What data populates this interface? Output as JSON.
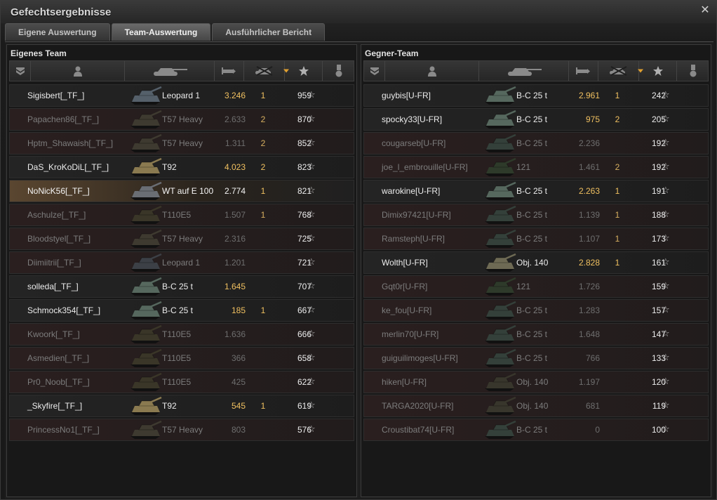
{
  "window": {
    "title": "Gefechtsergebnisse"
  },
  "tabs": [
    "Eigene Auswertung",
    "Team-Auswertung",
    "Ausführlicher Bericht"
  ],
  "active_tab": 1,
  "icons": {
    "close": "close-icon",
    "columns": [
      "rank-chevron-icon",
      "player-icon",
      "tank-icon",
      "damage-icon",
      "kills-icon",
      "star-icon",
      "medal-icon"
    ],
    "row_star": "☆"
  },
  "colors": {
    "damage_alive": "#f0c060",
    "self_row": "#5a4630"
  },
  "own_team": {
    "title": "Eigenes Team",
    "rows": [
      {
        "player": "Sigisbert[_TF_]",
        "tank": "Leopard 1",
        "damage": "3.246",
        "frags": "1",
        "xp": "959",
        "state": "alive",
        "tank_color": "#55606a"
      },
      {
        "player": "Papachen86[_TF_]",
        "tank": "T57 Heavy",
        "damage": "2.633",
        "frags": "2",
        "xp": "870",
        "state": "dead",
        "tank_color": "#3e3a30"
      },
      {
        "player": "Hptm_Shawaish[_TF_]",
        "tank": "T57 Heavy",
        "damage": "1.311",
        "frags": "2",
        "xp": "852",
        "state": "dead",
        "tank_color": "#3e3a30"
      },
      {
        "player": "DaS_KroKoDiL[_TF_]",
        "tank": "T92",
        "damage": "4.023",
        "frags": "2",
        "xp": "823",
        "state": "alive",
        "tank_color": "#8a7a50"
      },
      {
        "player": "NoNicK56[_TF_]",
        "tank": "WT auf E 100",
        "damage": "2.774",
        "frags": "1",
        "xp": "821",
        "state": "self",
        "tank_color": "#6a6e74"
      },
      {
        "player": "Aschulze[_TF_]",
        "tank": "T110E5",
        "damage": "1.507",
        "frags": "1",
        "xp": "768",
        "state": "dead",
        "tank_color": "#3a3628"
      },
      {
        "player": "Bloodstyel[_TF_]",
        "tank": "T57 Heavy",
        "damage": "2.316",
        "frags": "",
        "xp": "725",
        "state": "dead",
        "tank_color": "#3e3a30"
      },
      {
        "player": "Diimiitrii[_TF_]",
        "tank": "Leopard 1",
        "damage": "1.201",
        "frags": "",
        "xp": "721",
        "state": "dead",
        "tank_color": "#3c4046"
      },
      {
        "player": "solleda[_TF_]",
        "tank": "B-C 25 t",
        "damage": "1.645",
        "frags": "",
        "xp": "707",
        "state": "alive",
        "tank_color": "#56685e"
      },
      {
        "player": "Schmock354[_TF_]",
        "tank": "B-C 25 t",
        "damage": "185",
        "frags": "1",
        "xp": "667",
        "state": "alive",
        "tank_color": "#56685e"
      },
      {
        "player": "Kwoork[_TF_]",
        "tank": "T110E5",
        "damage": "1.636",
        "frags": "",
        "xp": "666",
        "state": "dead",
        "tank_color": "#3a3628"
      },
      {
        "player": "Asmedien[_TF_]",
        "tank": "T110E5",
        "damage": "366",
        "frags": "",
        "xp": "658",
        "state": "dead",
        "tank_color": "#3a3628"
      },
      {
        "player": "Pr0_Noob[_TF_]",
        "tank": "T110E5",
        "damage": "425",
        "frags": "",
        "xp": "622",
        "state": "dead",
        "tank_color": "#3a3628"
      },
      {
        "player": "_Skyfire[_TF_]",
        "tank": "T92",
        "damage": "545",
        "frags": "1",
        "xp": "619",
        "state": "alive",
        "tank_color": "#8a7a50"
      },
      {
        "player": "PrincessNo1[_TF_]",
        "tank": "T57 Heavy",
        "damage": "803",
        "frags": "",
        "xp": "576",
        "state": "dead",
        "tank_color": "#3e3a30"
      }
    ]
  },
  "enemy_team": {
    "title": "Gegner-Team",
    "rows": [
      {
        "player": "guybis[U-FR]",
        "tank": "B-C 25 t",
        "damage": "2.961",
        "frags": "1",
        "xp": "242",
        "state": "alive",
        "tank_color": "#56685e"
      },
      {
        "player": "spocky33[U-FR]",
        "tank": "B-C 25 t",
        "damage": "975",
        "frags": "2",
        "xp": "205",
        "state": "alive",
        "tank_color": "#56685e"
      },
      {
        "player": "cougarseb[U-FR]",
        "tank": "B-C 25 t",
        "damage": "2.236",
        "frags": "",
        "xp": "192",
        "state": "dead",
        "tank_color": "#34403a"
      },
      {
        "player": "joe_l_embrouille[U-FR]",
        "tank": "121",
        "damage": "1.461",
        "frags": "2",
        "xp": "192",
        "state": "dead",
        "tank_color": "#2e3a2a"
      },
      {
        "player": "warokine[U-FR]",
        "tank": "B-C 25 t",
        "damage": "2.263",
        "frags": "1",
        "xp": "191",
        "state": "alive",
        "tank_color": "#56685e"
      },
      {
        "player": "Dimix97421[U-FR]",
        "tank": "B-C 25 t",
        "damage": "1.139",
        "frags": "1",
        "xp": "188",
        "state": "dead",
        "tank_color": "#34403a"
      },
      {
        "player": "Ramsteph[U-FR]",
        "tank": "B-C 25 t",
        "damage": "1.107",
        "frags": "1",
        "xp": "173",
        "state": "dead",
        "tank_color": "#34403a"
      },
      {
        "player": "Wolth[U-FR]",
        "tank": "Obj. 140",
        "damage": "2.828",
        "frags": "1",
        "xp": "161",
        "state": "alive",
        "tank_color": "#6e6a54"
      },
      {
        "player": "Gqt0r[U-FR]",
        "tank": "121",
        "damage": "1.726",
        "frags": "",
        "xp": "159",
        "state": "dead",
        "tank_color": "#2e3a2a"
      },
      {
        "player": "ke_fou[U-FR]",
        "tank": "B-C 25 t",
        "damage": "1.283",
        "frags": "",
        "xp": "157",
        "state": "dead",
        "tank_color": "#34403a"
      },
      {
        "player": "merlin70[U-FR]",
        "tank": "B-C 25 t",
        "damage": "1.648",
        "frags": "",
        "xp": "147",
        "state": "dead",
        "tank_color": "#34403a"
      },
      {
        "player": "guiguilimoges[U-FR]",
        "tank": "B-C 25 t",
        "damage": "766",
        "frags": "",
        "xp": "133",
        "state": "dead",
        "tank_color": "#34403a"
      },
      {
        "player": "hiken[U-FR]",
        "tank": "Obj. 140",
        "damage": "1.197",
        "frags": "",
        "xp": "120",
        "state": "dead",
        "tank_color": "#38362c"
      },
      {
        "player": "TARGA2020[U-FR]",
        "tank": "Obj. 140",
        "damage": "681",
        "frags": "",
        "xp": "119",
        "state": "dead",
        "tank_color": "#38362c"
      },
      {
        "player": "Croustibat74[U-FR]",
        "tank": "B-C 25 t",
        "damage": "0",
        "frags": "",
        "xp": "100",
        "state": "dead",
        "tank_color": "#34403a"
      }
    ]
  }
}
